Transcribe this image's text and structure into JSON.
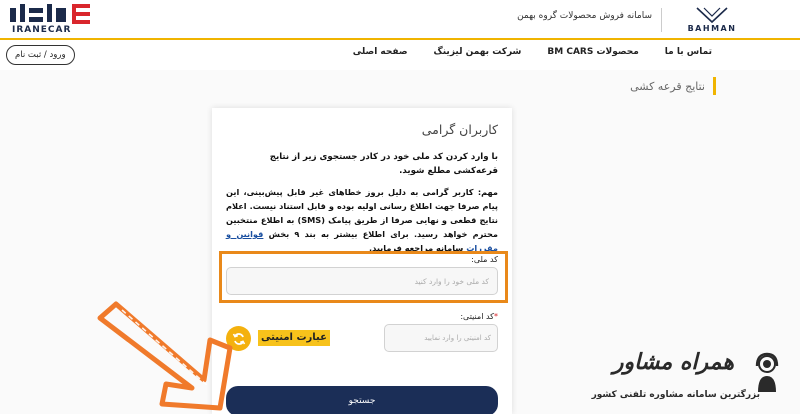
{
  "header": {
    "portal_title": "سامانه فروش محصولات گروه بهمن",
    "bahman_logo_text": "BAHMAN",
    "iranecar_logo_text": "IRANECAR"
  },
  "nav": {
    "items": [
      "صفحه اصلی",
      "شرکت بهمن لیزینگ",
      "محصولات BM CARS",
      "تماس با ما"
    ],
    "login_label": "ورود / ثبت نام"
  },
  "page": {
    "title": "نتایج قرعه کشی"
  },
  "card": {
    "title": "کاربران گرامی",
    "intro": "با وارد کردن کد ملی خود در کادر جستجوی زیر از نتایج قرعه‌کشی مطلع شوید.",
    "important_label": "مهم:",
    "important_text": "کاربر گرامی به دلیل بروز خطاهای غیر قابل پیش‌بینی، این پیام صرفا جهت اطلاع رسانی اولیه بوده و قابل استناد نیست. اعلام نتایج قطعی و نهایی صرفا از طریق پیامک (SMS) به اطلاع منتخبین محترم خواهد رسید. برای اطلاع بیشتر به بند ۹ بخش",
    "rules_link": "قوانین و مقررات",
    "important_tail": "سامانه مراجعه فرمایید.",
    "national_code_label": "کد ملی:",
    "national_code_placeholder": "کد ملی خود را وارد کنید",
    "national_code_value": "",
    "security_code_label": "کد امنیتی:",
    "security_required_mark": "*",
    "security_code_placeholder": "کد امنیتی را وارد نمایید",
    "security_code_value": "",
    "captcha_text": "عبارت امنیتی",
    "search_label": "جستجو"
  },
  "watermark": {
    "main": "همراه مشاور",
    "sub": "بزرگترین سامانه مشاوره تلفنی کشور"
  },
  "colors": {
    "accent": "#f0b400",
    "highlight_box": "#e9891a",
    "button": "#1b2e57",
    "link": "#1a4fa0"
  }
}
